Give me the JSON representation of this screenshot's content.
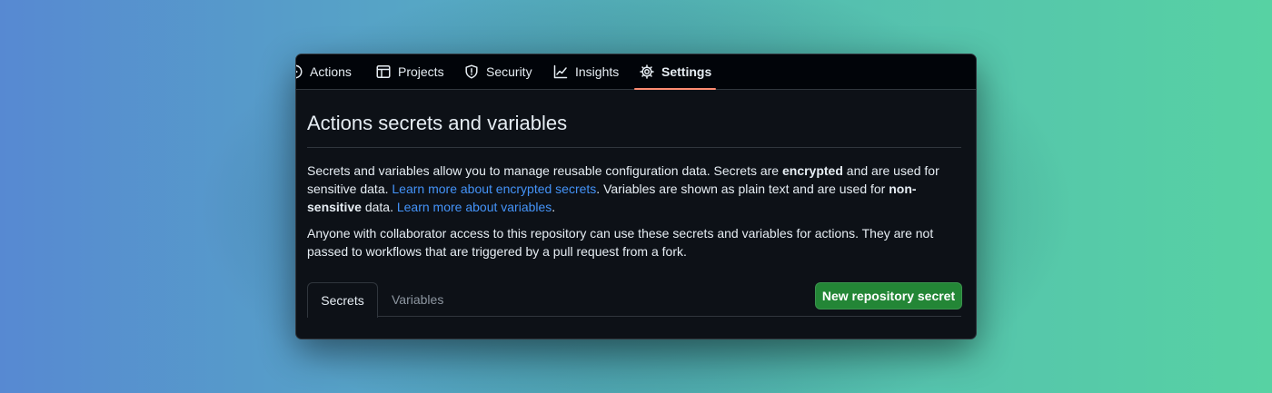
{
  "nav": {
    "tabs": [
      {
        "label": "Actions",
        "icon": "play-icon"
      },
      {
        "label": "Projects",
        "icon": "table-icon"
      },
      {
        "label": "Security",
        "icon": "shield-icon"
      },
      {
        "label": "Insights",
        "icon": "graph-icon"
      },
      {
        "label": "Settings",
        "icon": "gear-icon",
        "selected": true
      }
    ]
  },
  "page": {
    "title": "Actions secrets and variables",
    "intro": {
      "t1": "Secrets and variables allow you to manage reusable configuration data. Secrets are ",
      "b1": "encrypted",
      "t2": " and are used for sensitive data. ",
      "link1": "Learn more about encrypted secrets",
      "t3": ". Variables are shown as plain text and are used for ",
      "b2": "non-sensitive",
      "t4": " data. ",
      "link2": "Learn more about variables",
      "t5": "."
    },
    "access_note": "Anyone with collaborator access to this repository can use these secrets and variables for actions. They are not passed to workflows that are triggered by a pull request from a fork.",
    "subtabs": {
      "secrets": "Secrets",
      "variables": "Variables"
    },
    "new_secret_button": "New repository secret"
  },
  "colors": {
    "accent_underline": "#fd8c73",
    "link": "#4493f8",
    "primary_button": "#238636",
    "window_bg": "#0d1117"
  }
}
